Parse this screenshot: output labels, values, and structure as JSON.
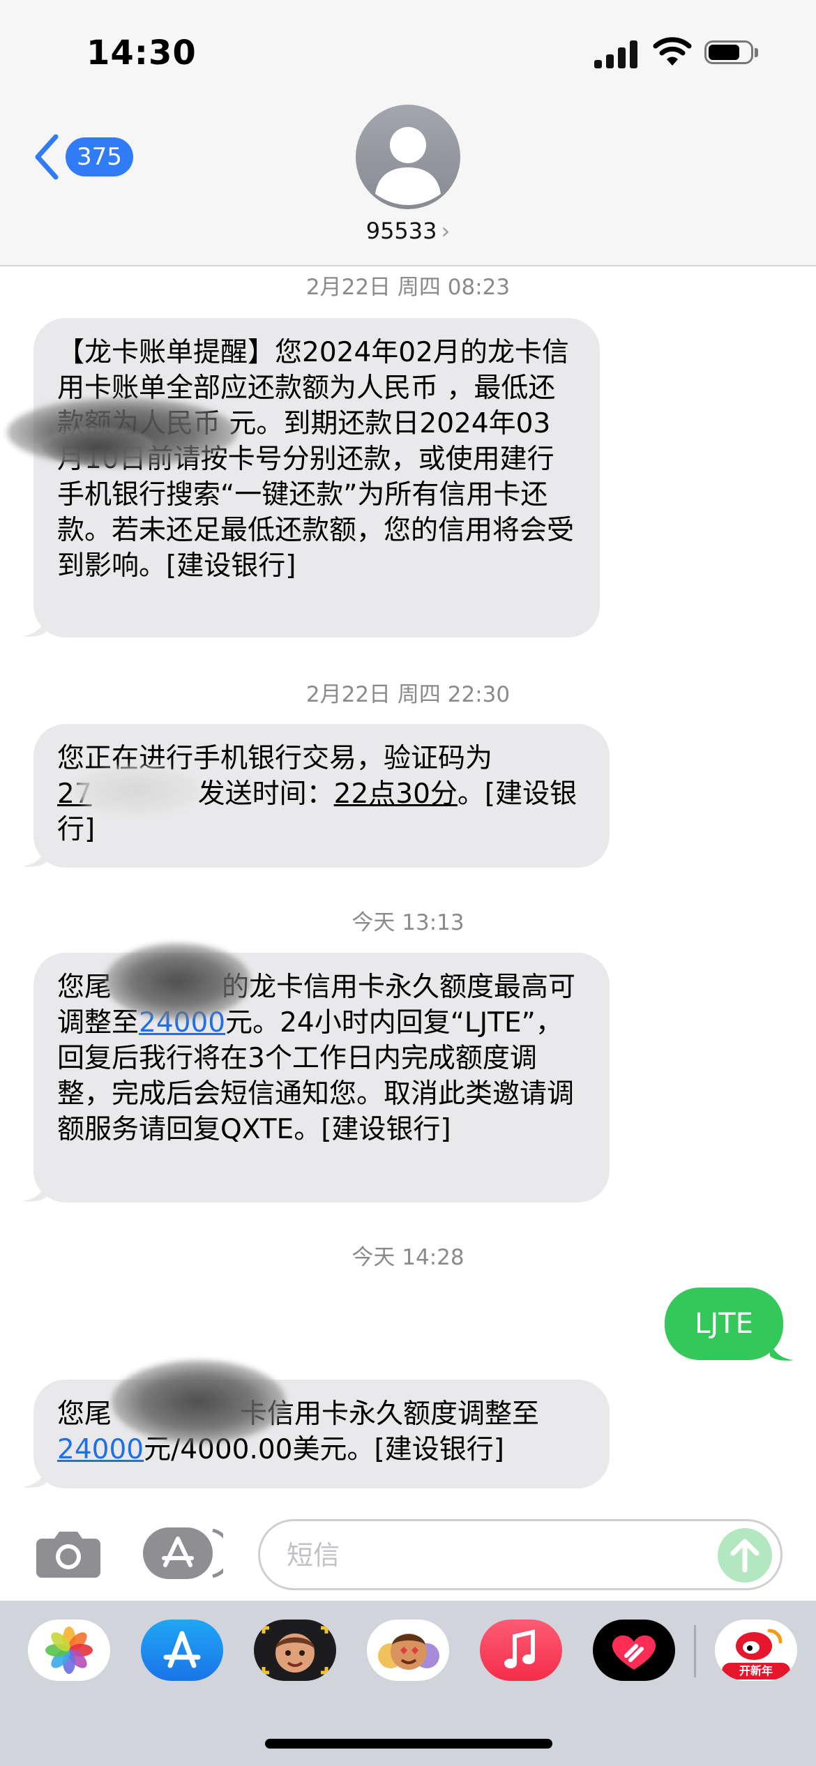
{
  "status": {
    "time": "14:30"
  },
  "header": {
    "back_count": "375",
    "contact": "95533",
    "contact_chevron": "›"
  },
  "messages": [
    {
      "timestamp": "2月22日 周四 08:23"
    },
    {
      "text": "【龙卡账单提醒】您2024年02月的龙卡信用卡账单全部应还款额为人民币 ，最低还款额为人民币 元。到期还款日2024年03月10日前请按卡号分别还款，或使用建行手机银行搜索“一键还款”为所有信用卡还款。若未还足最低还款额，您的信用将会受到影响。[建设银行]"
    },
    {
      "timestamp": "2月22日 周四 22:30"
    },
    {
      "text_a": "您正在进行手机银行交易，验证码为",
      "text_b": "27",
      "text_c": "发送时间：",
      "text_d": "22点30分",
      "text_e": "。[建设银行]"
    },
    {
      "timestamp": "今天 13:13"
    },
    {
      "text_a": "您尾",
      "text_b": "的龙卡信用卡永久额度最高可调整至",
      "link": "24000",
      "text_c": "元。24小时内回复“LJTE”，回复后我行将在3个工作日内完成额度调整，完成后会短信通知您。取消此类邀请调额服务请回复QXTE。[建设银行]"
    },
    {
      "timestamp": "今天 14:28"
    },
    {
      "sent": "LJTE"
    },
    {
      "text_a": "您尾",
      "text_b": "卡信用卡永久额度调整至",
      "link": "24000",
      "text_c": "元/4000.00美元。[建设银行]"
    }
  ],
  "input": {
    "placeholder": "短信"
  },
  "apps": {
    "items": [
      {
        "name": "Photos",
        "icon": "photos-icon"
      },
      {
        "name": "App Store",
        "icon": "app-store-icon"
      },
      {
        "name": "Memoji",
        "icon": "memoji-icon"
      },
      {
        "name": "Animoji stickers",
        "icon": "animoji-icon"
      },
      {
        "name": "Music",
        "icon": "music-icon"
      },
      {
        "name": "Digital Touch",
        "icon": "digital-touch-icon"
      },
      {
        "name": "Weibo",
        "icon": "weibo-icon"
      }
    ],
    "weibo_badge": "开新年"
  },
  "colors": {
    "blue": "#2f7cf6",
    "green": "#34c759",
    "bubble_gray": "#e9e9eb"
  }
}
